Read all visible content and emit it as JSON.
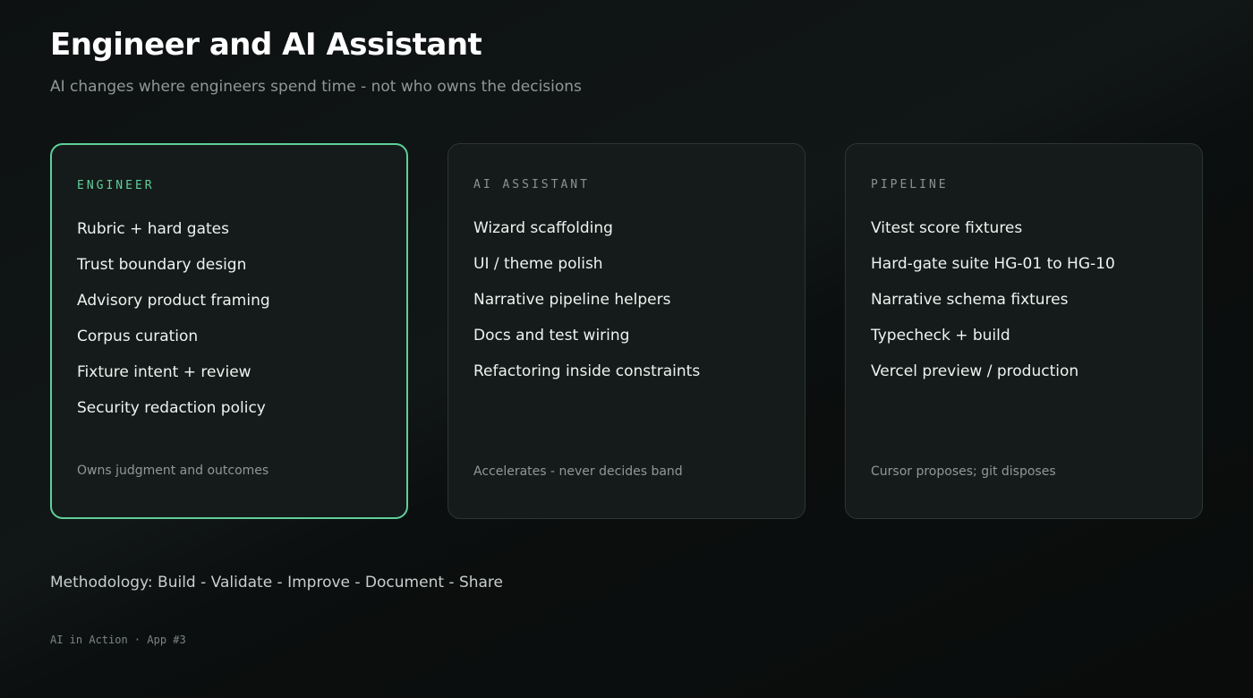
{
  "slide": {
    "title": "Engineer and AI Assistant",
    "subtitle": "AI changes where engineers spend time - not who owns the decisions",
    "methodology": "Methodology: Build - Validate - Improve - Document - Share",
    "footer": "AI in Action · App #3"
  },
  "cards": [
    {
      "label": "ENGINEER",
      "items": [
        "Rubric + hard gates",
        "Trust boundary design",
        "Advisory product framing",
        "Corpus curation",
        "Fixture intent + review",
        "Security redaction policy"
      ],
      "footer": "Owns judgment and outcomes"
    },
    {
      "label": "AI ASSISTANT",
      "items": [
        "Wizard scaffolding",
        "UI / theme polish",
        "Narrative pipeline helpers",
        "Docs and test wiring",
        "Refactoring inside constraints"
      ],
      "footer": "Accelerates - never decides band"
    },
    {
      "label": "PIPELINE",
      "items": [
        "Vitest score fixtures",
        "Hard-gate suite HG-01 to HG-10",
        "Narrative schema fixtures",
        "Typecheck + build",
        "Vercel preview / production"
      ],
      "footer": "Cursor proposes; git disposes"
    }
  ],
  "colors": {
    "accent": "#5fcf99",
    "background": "#0d1111",
    "card_background": "#151b1a",
    "card_border": "#2d3533"
  }
}
